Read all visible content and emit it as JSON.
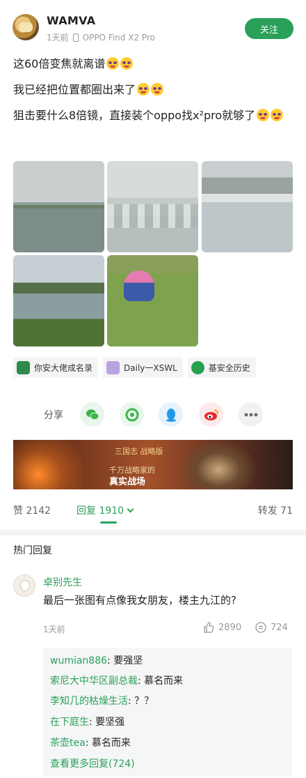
{
  "post": {
    "username": "WAMVA",
    "time": "1天前",
    "device": "OPPO Find X2 Pro",
    "follow_label": "关注",
    "lines": [
      "这60倍变焦就离谱",
      "我已经把位置都圈出来了",
      "狙击要什么8倍镜，直接装个oppo找x²pro就够了"
    ]
  },
  "topics": [
    {
      "label": "你安大佬成名录",
      "icon": "topic-green-icon"
    },
    {
      "label": "Daily一XSWL",
      "icon": "topic-purple-icon"
    },
    {
      "label": "基安全历史",
      "icon": "topic-green-round-icon"
    }
  ],
  "share": {
    "label": "分享",
    "targets": [
      "wechat-icon",
      "moments-icon",
      "qq-icon",
      "weibo-icon",
      "more-icon"
    ]
  },
  "ad": {
    "logo": "三国志 战略版",
    "line1": "千万战略家的",
    "line2": "真实战场"
  },
  "stats": {
    "likes_label": "赞 2142",
    "replies_label": "回复 1910",
    "reposts_label": "转发 71"
  },
  "hot": {
    "title": "热门回复",
    "comment": {
      "name": "卓别先生",
      "text": "最后一张图有点像我女朋友，楼主九江的?",
      "time": "1天前",
      "likes": "2890",
      "replies": "724"
    },
    "subreplies": [
      {
        "who": "wumian886",
        "text": ": 要强坚"
      },
      {
        "who": "索尼大中华区副总裁",
        "text": ": 慕名而来"
      },
      {
        "who": "李知几的枯燥生活",
        "text": ": ？？"
      },
      {
        "who": "在下庭生",
        "text": ": 要坚强"
      },
      {
        "who": "茶壶tea",
        "text": ": 慕名而来"
      }
    ],
    "more_label": "查看更多回复(724)"
  },
  "colors": {
    "accent": "#2aa05a",
    "muted": "#999999"
  }
}
